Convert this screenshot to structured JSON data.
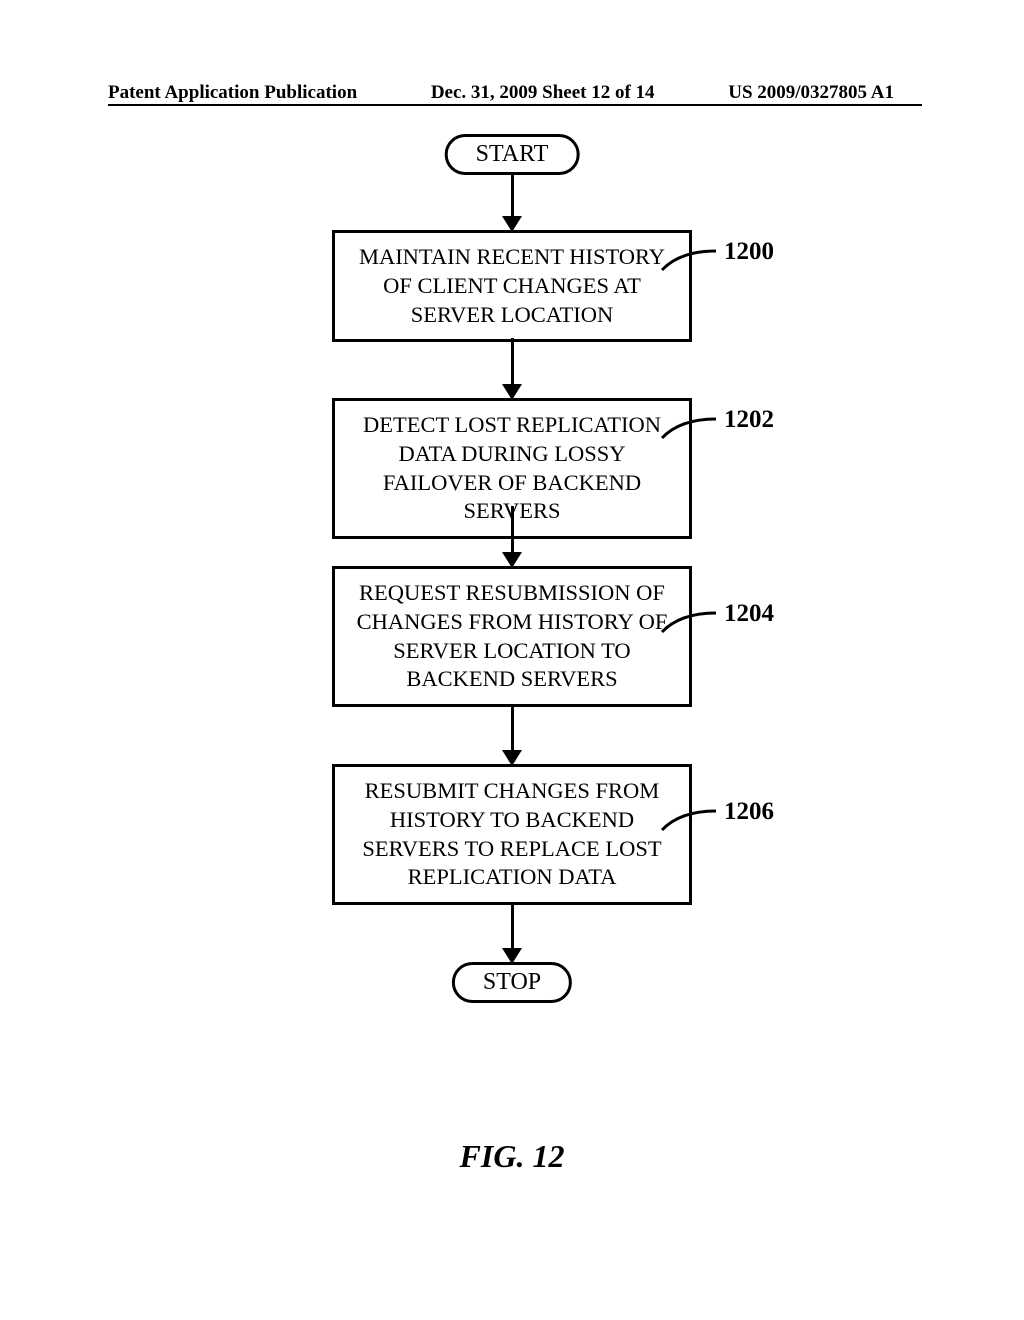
{
  "header": {
    "left": "Patent Application Publication",
    "center": "Dec. 31, 2009  Sheet 12 of 14",
    "right": "US 2009/0327805 A1"
  },
  "flow": {
    "start": "START",
    "step1": "MAINTAIN RECENT HISTORY OF CLIENT CHANGES AT SERVER LOCATION",
    "step2": "DETECT LOST REPLICATION DATA DURING LOSSY FAILOVER OF BACKEND SERVERS",
    "step3": "REQUEST RESUBMISSION OF CHANGES FROM HISTORY OF SERVER LOCATION TO BACKEND SERVERS",
    "step4": "RESUBMIT CHANGES FROM HISTORY TO BACKEND SERVERS TO REPLACE LOST REPLICATION DATA",
    "stop": "STOP"
  },
  "refs": {
    "r1": "1200",
    "r2": "1202",
    "r3": "1204",
    "r4": "1206"
  },
  "caption": "FIG. 12"
}
